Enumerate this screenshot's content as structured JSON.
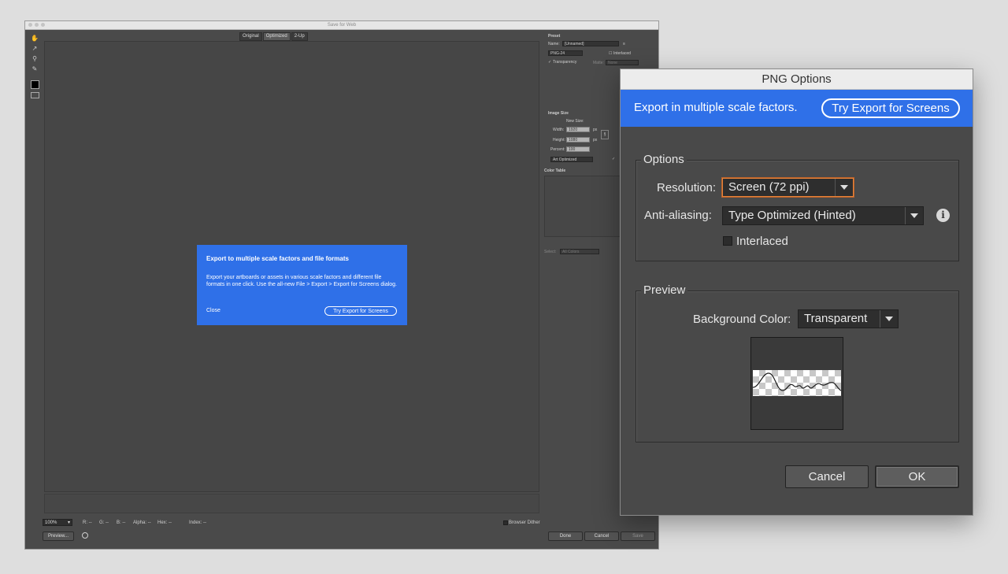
{
  "sfw": {
    "title": "Save for Web",
    "tabs": [
      "Original",
      "Optimized",
      "2-Up"
    ],
    "status": {
      "zoom": "100%",
      "r": "R: --",
      "g": "G: --",
      "b": "B: --",
      "alpha": "Alpha: --",
      "hex": "Hex: --",
      "index": "Index: --",
      "browser_dither": "Browser Dither"
    },
    "buttons": {
      "preview": "Preview...",
      "done": "Done",
      "cancel": "Cancel",
      "save": "Save"
    },
    "panel": {
      "preset_heading": "Preset",
      "name_label": "Name:",
      "name_value": "[Unnamed]",
      "format_value": "PNG-24",
      "interlaced": "Interlaced",
      "transparency": "Transparency",
      "matte_label": "Matte:",
      "matte_value": "None",
      "image_size_heading": "Image Size",
      "new_size": "New Size:",
      "width_label": "Width:",
      "width_value": "1920",
      "height_label": "Height:",
      "height_value": "1080",
      "percent_label": "Percent:",
      "percent_value": "100",
      "unit": "px",
      "quality_value": "Art Optimized",
      "color_table_heading": "Color Table",
      "select_label": "Select:",
      "select_value": "All Colors"
    }
  },
  "popup": {
    "title": "Export to multiple scale factors and file formats",
    "body": "Export your artboards or assets in various scale factors and different file formats in one click. Use the all-new File > Export > Export for Screens dialog.",
    "close": "Close",
    "try": "Try Export for Screens"
  },
  "png_options": {
    "title": "PNG Options",
    "banner_text": "Export in multiple scale factors.",
    "banner_button": "Try Export for Screens",
    "options_legend": "Options",
    "resolution_label": "Resolution:",
    "resolution_value": "Screen (72 ppi)",
    "antialias_label": "Anti-aliasing:",
    "antialias_value": "Type Optimized (Hinted)",
    "interlaced_label": "Interlaced",
    "interlaced_checked": false,
    "preview_legend": "Preview",
    "bg_color_label": "Background Color:",
    "bg_color_value": "Transparent",
    "cancel": "Cancel",
    "ok": "OK"
  },
  "colors": {
    "accent_blue": "#2f70e8",
    "focus_orange": "#e8833a",
    "dialog_bg": "#494949"
  }
}
